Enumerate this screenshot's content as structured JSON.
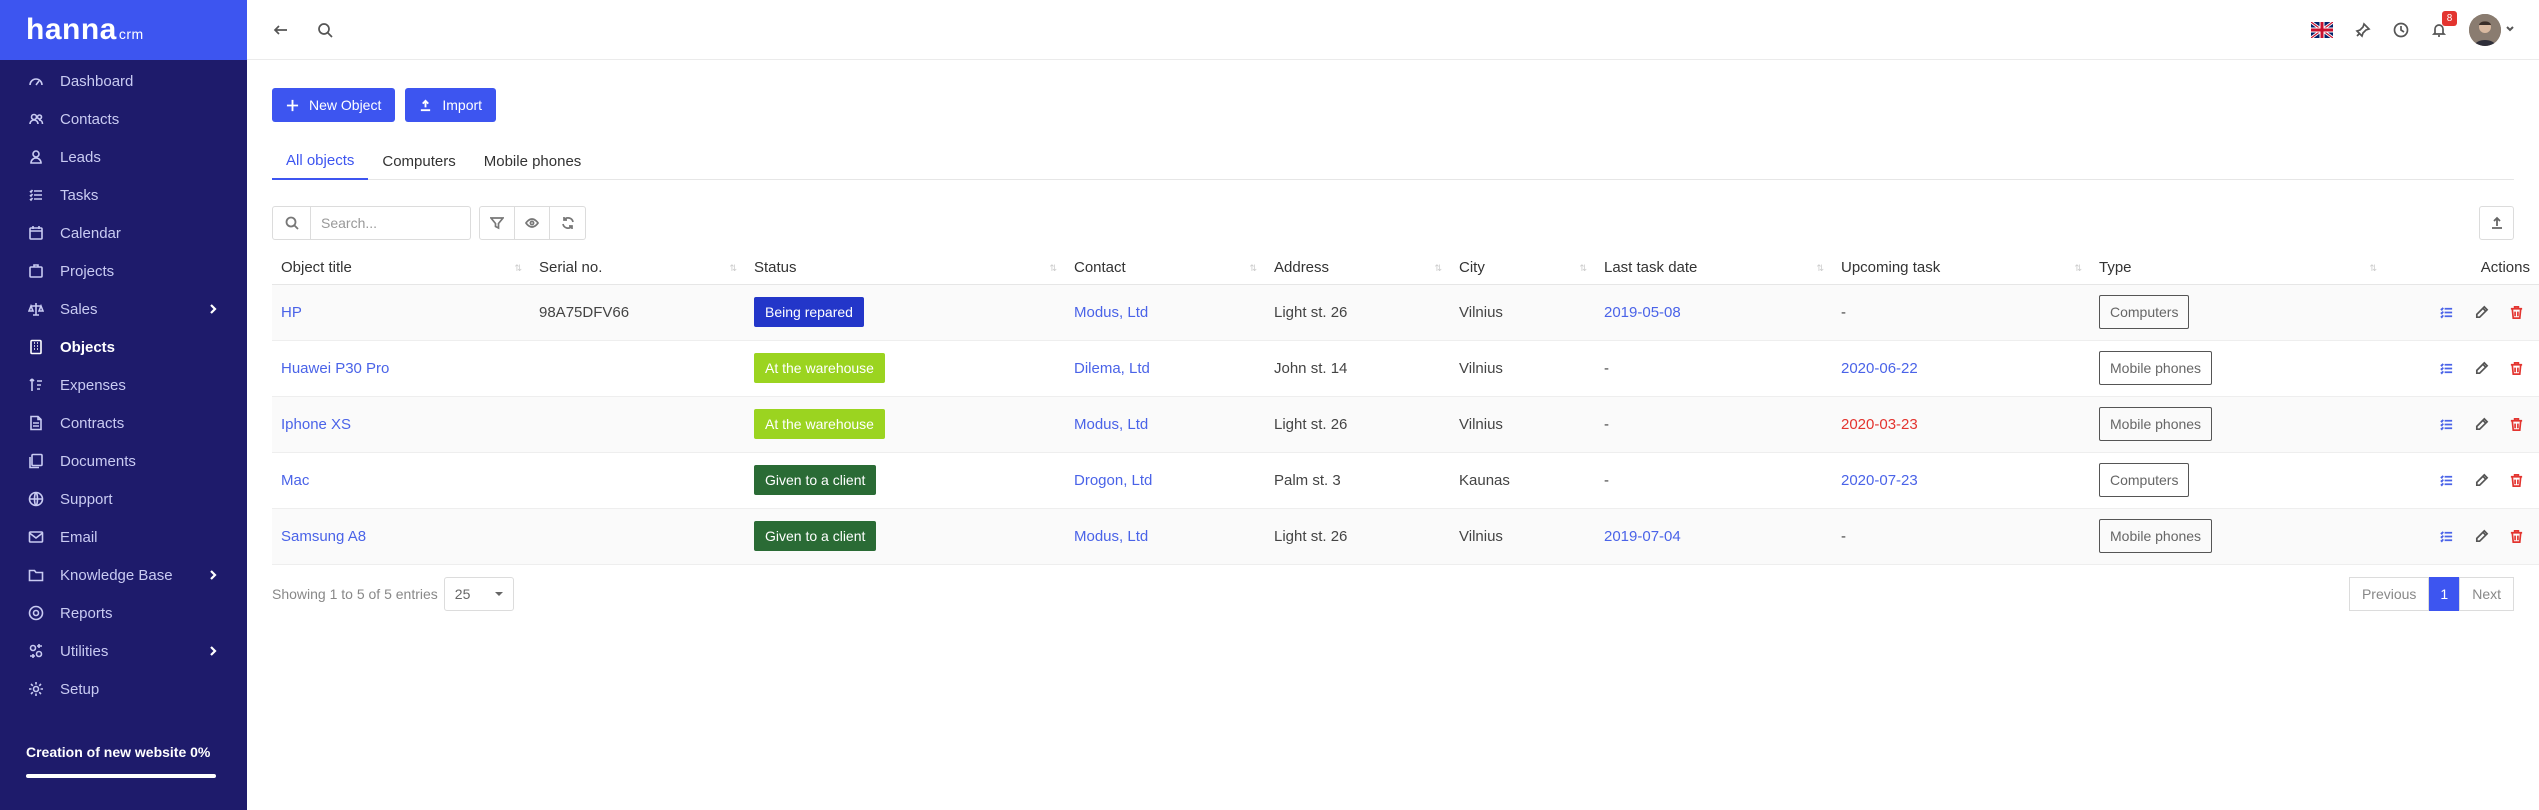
{
  "brand": {
    "name": "hanna",
    "suffix": "crm"
  },
  "sidebar": {
    "items": [
      {
        "label": "Dashboard",
        "icon": "dashboard-icon"
      },
      {
        "label": "Contacts",
        "icon": "users-icon"
      },
      {
        "label": "Leads",
        "icon": "leads-icon"
      },
      {
        "label": "Tasks",
        "icon": "tasks-icon"
      },
      {
        "label": "Calendar",
        "icon": "calendar-icon"
      },
      {
        "label": "Projects",
        "icon": "projects-icon"
      },
      {
        "label": "Sales",
        "icon": "sales-icon",
        "expandable": true
      },
      {
        "label": "Objects",
        "icon": "objects-icon",
        "active": true
      },
      {
        "label": "Expenses",
        "icon": "expenses-icon"
      },
      {
        "label": "Contracts",
        "icon": "contracts-icon"
      },
      {
        "label": "Documents",
        "icon": "documents-icon"
      },
      {
        "label": "Support",
        "icon": "support-icon"
      },
      {
        "label": "Email",
        "icon": "email-icon"
      },
      {
        "label": "Knowledge Base",
        "icon": "folder-icon",
        "expandable": true
      },
      {
        "label": "Reports",
        "icon": "reports-icon"
      },
      {
        "label": "Utilities",
        "icon": "utilities-icon",
        "expandable": true
      },
      {
        "label": "Setup",
        "icon": "gear-icon"
      }
    ],
    "progress": {
      "label": "Creation of new website 0%",
      "percent": 0
    }
  },
  "topbar": {
    "notification_count": "8"
  },
  "toolbar": {
    "new_object_label": "New Object",
    "import_label": "Import"
  },
  "tabs": [
    {
      "label": "All objects",
      "active": true
    },
    {
      "label": "Computers"
    },
    {
      "label": "Mobile phones"
    }
  ],
  "search": {
    "placeholder": "Search..."
  },
  "table": {
    "columns": [
      "Object title",
      "Serial no.",
      "Status",
      "Contact",
      "Address",
      "City",
      "Last task date",
      "Upcoming task",
      "Type",
      "Actions"
    ],
    "rows": [
      {
        "title": "HP",
        "serial": "98A75DFV66",
        "status": "Being repared",
        "status_color": "#2336c9",
        "contact": "Modus, Ltd",
        "address": "Light st. 26",
        "city": "Vilnius",
        "last_task": "2019-05-08",
        "upcoming": "-",
        "upcoming_overdue": false,
        "type": "Computers"
      },
      {
        "title": "Huawei P30 Pro",
        "serial": "",
        "status": "At the warehouse",
        "status_color": "#9bd420",
        "contact": "Dilema, Ltd",
        "address": "John st. 14",
        "city": "Vilnius",
        "last_task": "-",
        "upcoming": "2020-06-22",
        "upcoming_overdue": false,
        "type": "Mobile phones"
      },
      {
        "title": "Iphone XS",
        "serial": "",
        "status": "At the warehouse",
        "status_color": "#9bd420",
        "contact": "Modus, Ltd",
        "address": "Light st. 26",
        "city": "Vilnius",
        "last_task": "-",
        "upcoming": "2020-03-23",
        "upcoming_overdue": true,
        "type": "Mobile phones"
      },
      {
        "title": "Mac",
        "serial": "",
        "status": "Given to a client",
        "status_color": "#2a6b35",
        "contact": "Drogon, Ltd",
        "address": "Palm st. 3",
        "city": "Kaunas",
        "last_task": "-",
        "upcoming": "2020-07-23",
        "upcoming_overdue": false,
        "type": "Computers"
      },
      {
        "title": "Samsung A8",
        "serial": "",
        "status": "Given to a client",
        "status_color": "#2a6b35",
        "contact": "Modus, Ltd",
        "address": "Light st. 26",
        "city": "Vilnius",
        "last_task": "2019-07-04",
        "upcoming": "-",
        "upcoming_overdue": false,
        "type": "Mobile phones"
      }
    ]
  },
  "footer": {
    "showing": "Showing 1 to 5 of 5 entries",
    "page_size": "25",
    "pager": {
      "previous": "Previous",
      "current": "1",
      "next": "Next"
    }
  },
  "colors": {
    "sidebar": "#1e1b6b",
    "accent": "#3d55f0",
    "link": "#4a63e8",
    "danger": "#e3342f"
  }
}
